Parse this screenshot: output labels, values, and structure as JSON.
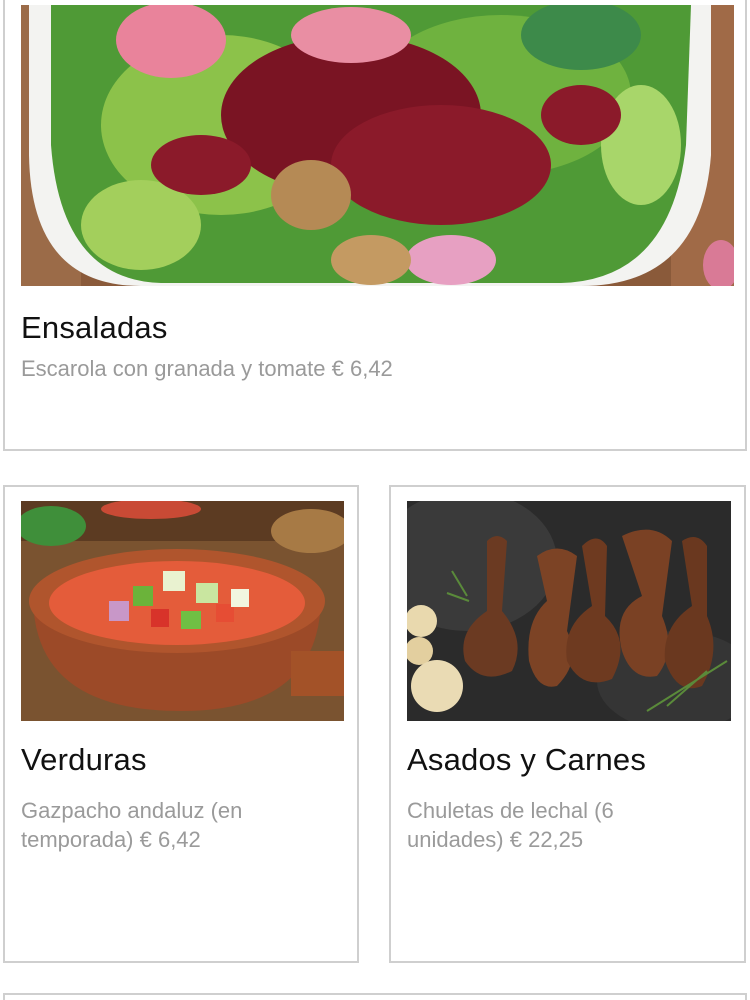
{
  "cards": [
    {
      "title": "Ensaladas",
      "description": "Escarola con granada y tomate € 6,42",
      "image": "salad-bowl-image"
    },
    {
      "title": "Verduras",
      "description": "Gazpacho andaluz (en temporada) € 6,42",
      "image": "gazpacho-bowl-image"
    },
    {
      "title": "Asados y Carnes",
      "description": "Chuletas de lechal (6 unidades) € 22,25",
      "image": "lamb-chops-image"
    }
  ],
  "colors": {
    "card_border": "#cfcfcf",
    "title_text": "#111111",
    "description_text": "#9a9a9a",
    "page_background": "#ffffff"
  }
}
